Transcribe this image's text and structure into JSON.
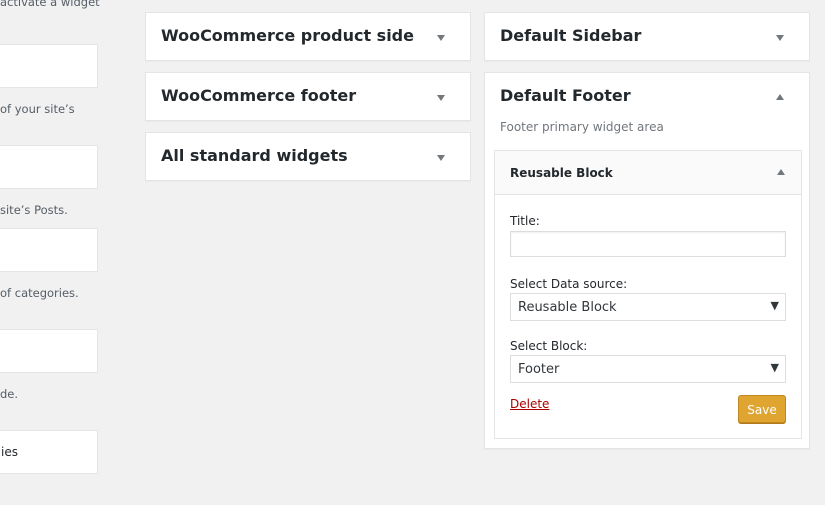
{
  "available_widgets": {
    "snippets": [
      "activate a widget",
      "of your site’s",
      "site’s Posts.",
      "of categories.",
      "de."
    ],
    "box_labels": [
      "",
      "",
      "",
      "",
      "ies"
    ]
  },
  "sidebars": {
    "woo_product_side": "WooCommerce product side",
    "woo_footer": "WooCommerce footer",
    "all_standard": "All standard widgets",
    "default_sidebar": "Default Sidebar",
    "default_footer": {
      "title": "Default Footer",
      "description": "Footer primary widget area",
      "widget": {
        "title": "Reusable Block",
        "fields": {
          "title_label": "Title:",
          "title_value": "",
          "source_label": "Select Data source:",
          "source_value": "Reusable Block",
          "block_label": "Select Block:",
          "block_value": "Footer"
        },
        "delete_label": "Delete",
        "save_label": "Save"
      }
    }
  },
  "icons": {
    "collapse_down": "triangle-down",
    "collapse_up": "triangle-up",
    "select_caret": "▼"
  },
  "colors": {
    "save_button": "#e0a530",
    "delete_link": "#aa0000",
    "background": "#f1f1f1"
  }
}
